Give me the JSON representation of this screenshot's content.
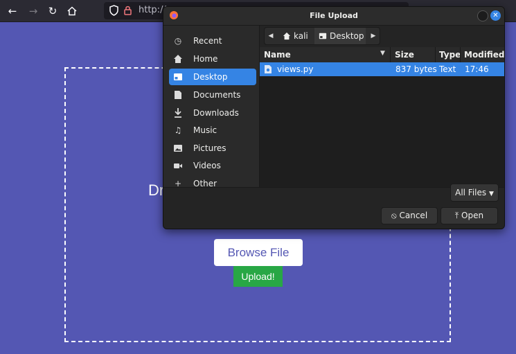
{
  "browser": {
    "back_icon": "arrow-left-icon",
    "forward_icon": "arrow-right-icon",
    "reload_icon": "reload-icon",
    "home_icon": "home-icon",
    "url": "http://"
  },
  "page": {
    "drop_text": "Dr",
    "browse_label": "Browse File",
    "upload_label": "Upload!",
    "colors": {
      "background": "#5457b3",
      "upload_button": "#28a745"
    }
  },
  "dialog": {
    "title": "File Upload",
    "sidebar": {
      "items": [
        {
          "label": "Recent",
          "icon": "clock-icon"
        },
        {
          "label": "Home",
          "icon": "home-icon"
        },
        {
          "label": "Desktop",
          "icon": "desktop-icon",
          "active": true
        },
        {
          "label": "Documents",
          "icon": "document-icon"
        },
        {
          "label": "Downloads",
          "icon": "download-icon"
        },
        {
          "label": "Music",
          "icon": "music-icon"
        },
        {
          "label": "Pictures",
          "icon": "picture-icon"
        },
        {
          "label": "Videos",
          "icon": "video-icon"
        },
        {
          "label": "Other Locations",
          "icon": "plus-icon"
        }
      ]
    },
    "pathbar": {
      "segments": [
        "kali",
        "Desktop"
      ]
    },
    "columns": [
      "Name",
      "Size",
      "Type",
      "Modified"
    ],
    "files": [
      {
        "name": "views.py",
        "size": "837 bytes",
        "type": "Text",
        "modified": "17:46"
      }
    ],
    "filter_label": "All Files",
    "cancel_label": "Cancel",
    "open_label": "Open",
    "colors": {
      "accent": "#3584e4"
    }
  }
}
